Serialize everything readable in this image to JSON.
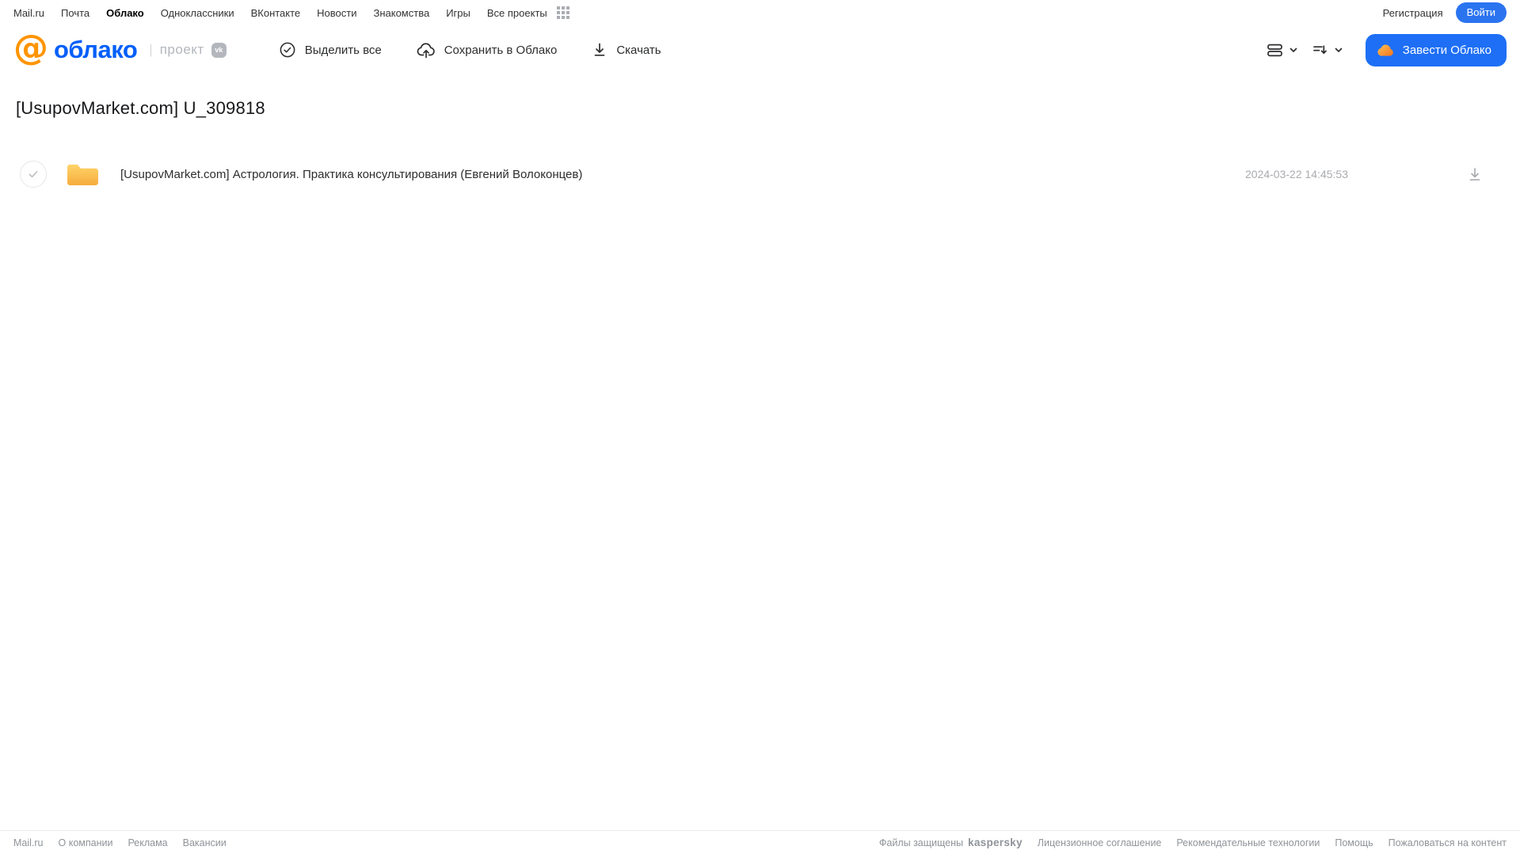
{
  "portal_nav": {
    "items": [
      "Mail.ru",
      "Почта",
      "Облако",
      "Одноклассники",
      "ВКонтакте",
      "Новости",
      "Знакомства",
      "Игры",
      "Все проекты"
    ],
    "active_item": "Облако",
    "register_label": "Регистрация",
    "login_label": "Войти"
  },
  "header": {
    "logo_at": "@",
    "logo_text": "облако",
    "project_divider": "|",
    "project_label": "проект",
    "vk_badge": "vk",
    "toolbar": {
      "select_all": "Выделить все",
      "save_to_cloud": "Сохранить в Облако",
      "download": "Скачать"
    },
    "get_cloud_button": "Завести Облако"
  },
  "content": {
    "title": "[UsupovMarket.com] U_309818",
    "files": [
      {
        "type": "folder",
        "name": "[UsupovMarket.com] Астрология. Практика консультирования (Евгений Волоконцев)",
        "date": "2024-03-22 14:45:53"
      }
    ]
  },
  "footer": {
    "left_links": [
      "Mail.ru",
      "О компании",
      "Реклама",
      "Вакансии"
    ],
    "protected_text": "Файлы защищены",
    "kaspersky_logo": "kaspersky",
    "right_links": [
      "Лицензионное соглашение",
      "Рекомендательные технологии",
      "Помощь",
      "Пожаловаться на контент"
    ]
  },
  "colors": {
    "accent_blue": "#1e6ff5",
    "logo_blue": "#005ff9",
    "logo_orange": "#ff9400",
    "folder_yellow_top": "#ffd468",
    "folder_yellow_bottom": "#f6ac3e",
    "kaspersky_teal": "#117a6a",
    "muted_gray": "#a9abaf"
  }
}
